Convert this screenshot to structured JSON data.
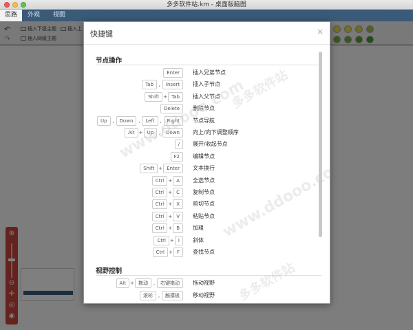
{
  "window": {
    "title": "多多软件站.km - 桌面版脑图"
  },
  "tabs": [
    {
      "label": "思路"
    },
    {
      "label": "外观"
    },
    {
      "label": "视图"
    }
  ],
  "toolbar": {
    "insert_child": "插入下级主题",
    "insert_parent": "插入上",
    "insert_sibling": "插入同级主题"
  },
  "dialog": {
    "title": "快捷键",
    "close_symbol": "×",
    "sections": [
      {
        "title": "节点操作",
        "rows": [
          {
            "keys": [
              "Enter"
            ],
            "seps": [],
            "desc": "插入兄弟节点"
          },
          {
            "keys": [
              "Tab",
              "Insert"
            ],
            "seps": [
              ","
            ],
            "desc": "插入子节点"
          },
          {
            "keys": [
              "Shift",
              "Tab"
            ],
            "seps": [
              "+"
            ],
            "desc": "插入父节点"
          },
          {
            "keys": [
              "Delete"
            ],
            "seps": [],
            "desc": "删除节点"
          },
          {
            "keys": [
              "Up",
              "Down",
              "Left",
              "Right"
            ],
            "seps": [
              ",",
              ",",
              ","
            ],
            "desc": "节点导航"
          },
          {
            "keys": [
              "Alt",
              "Up",
              "Down"
            ],
            "seps": [
              "+",
              ","
            ],
            "desc": "向上/向下调整顺序"
          },
          {
            "keys": [
              "/"
            ],
            "seps": [],
            "desc": "展开/收起节点"
          },
          {
            "keys": [
              "F2"
            ],
            "seps": [],
            "desc": "编辑节点"
          },
          {
            "keys": [
              "Shift",
              "Enter"
            ],
            "seps": [
              "+"
            ],
            "desc": "文本换行"
          },
          {
            "keys": [
              "Ctrl",
              "A"
            ],
            "seps": [
              "+"
            ],
            "desc": "全选节点"
          },
          {
            "keys": [
              "Ctrl",
              "C"
            ],
            "seps": [
              "+"
            ],
            "desc": "复制节点"
          },
          {
            "keys": [
              "Ctrl",
              "X"
            ],
            "seps": [
              "+"
            ],
            "desc": "剪切节点"
          },
          {
            "keys": [
              "Ctrl",
              "V"
            ],
            "seps": [
              "+"
            ],
            "desc": "粘贴节点"
          },
          {
            "keys": [
              "Ctrl",
              "B"
            ],
            "seps": [
              "+"
            ],
            "desc": "加粗"
          },
          {
            "keys": [
              "Ctrl",
              "I"
            ],
            "seps": [
              "+"
            ],
            "desc": "斜体"
          },
          {
            "keys": [
              "Ctrl",
              "F"
            ],
            "seps": [
              "+"
            ],
            "desc": "查找节点"
          }
        ]
      },
      {
        "title": "视野控制",
        "rows": [
          {
            "keys": [
              "Alt",
              "拖动",
              "右键拖动"
            ],
            "seps": [
              "+",
              ","
            ],
            "desc": "拖动视野"
          },
          {
            "keys": [
              "滚轮",
              "触摸板"
            ],
            "seps": [
              ","
            ],
            "desc": "移动视野"
          }
        ]
      }
    ]
  },
  "watermark": "www.ddooo.com",
  "watermark_cn": "多多软件站"
}
